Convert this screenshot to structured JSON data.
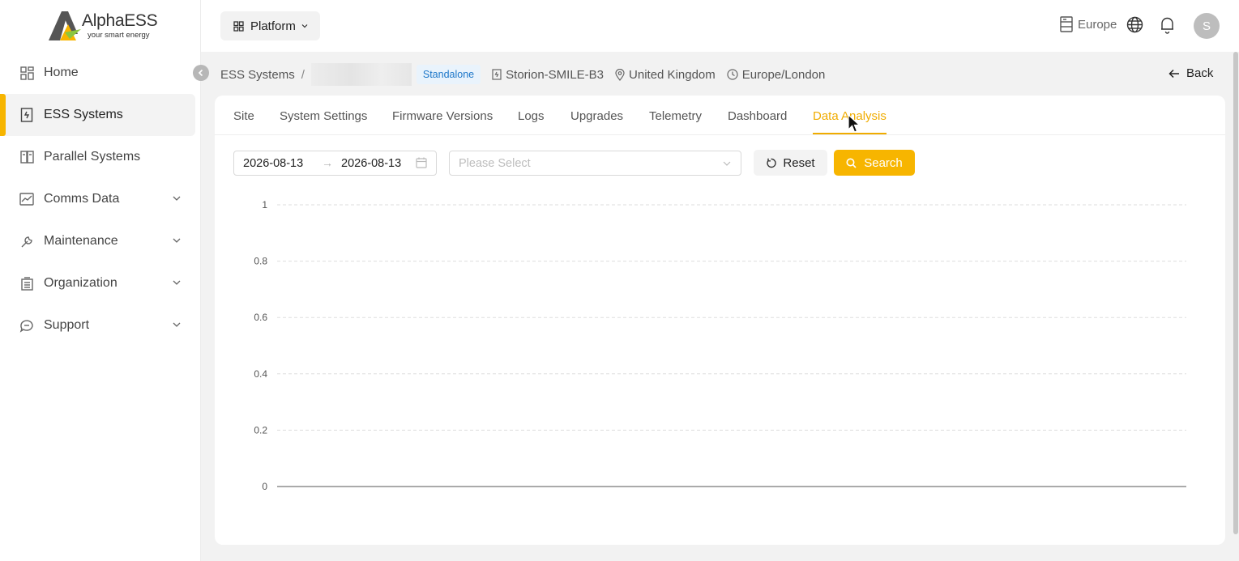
{
  "brand": {
    "name": "AlphaESS",
    "tagline": "your smart energy"
  },
  "topbar": {
    "platform_label": "Platform",
    "region": "Europe",
    "avatar_initial": "S"
  },
  "sidebar": {
    "items": [
      {
        "label": "Home",
        "icon": "home-grid-icon",
        "active": false,
        "expandable": false
      },
      {
        "label": "ESS Systems",
        "icon": "building-icon",
        "active": true,
        "expandable": false
      },
      {
        "label": "Parallel Systems",
        "icon": "book-icon",
        "active": false,
        "expandable": false
      },
      {
        "label": "Comms Data",
        "icon": "chart-line-icon",
        "active": false,
        "expandable": true
      },
      {
        "label": "Maintenance",
        "icon": "wrench-icon",
        "active": false,
        "expandable": true
      },
      {
        "label": "Organization",
        "icon": "office-icon",
        "active": false,
        "expandable": true
      },
      {
        "label": "Support",
        "icon": "chat-icon",
        "active": false,
        "expandable": true
      }
    ]
  },
  "breadcrumb": {
    "root": "ESS Systems",
    "separator": "/",
    "mode_tag": "Standalone",
    "model": "Storion-SMILE-B3",
    "country": "United Kingdom",
    "timezone": "Europe/London",
    "back_label": "Back"
  },
  "tabs": [
    {
      "label": "Site",
      "active": false
    },
    {
      "label": "System Settings",
      "active": false
    },
    {
      "label": "Firmware Versions",
      "active": false
    },
    {
      "label": "Logs",
      "active": false
    },
    {
      "label": "Upgrades",
      "active": false
    },
    {
      "label": "Telemetry",
      "active": false
    },
    {
      "label": "Dashboard",
      "active": false
    },
    {
      "label": "Data Analysis",
      "active": true
    }
  ],
  "filters": {
    "date_start": "2026-08-13",
    "date_end": "2026-08-13",
    "arrow": "→",
    "select_placeholder": "Please Select",
    "reset_label": "Reset",
    "search_label": "Search"
  },
  "colors": {
    "accent": "#f7b500",
    "tag_bg": "#e9f3fc",
    "tag_text": "#1d77c9"
  },
  "chart_data": {
    "type": "line",
    "title": "",
    "xlabel": "",
    "ylabel": "",
    "ylim": [
      0,
      1
    ],
    "y_ticks": [
      "1",
      "0.8",
      "0.6",
      "0.4",
      "0.2",
      "0"
    ],
    "grid": true,
    "series": []
  }
}
